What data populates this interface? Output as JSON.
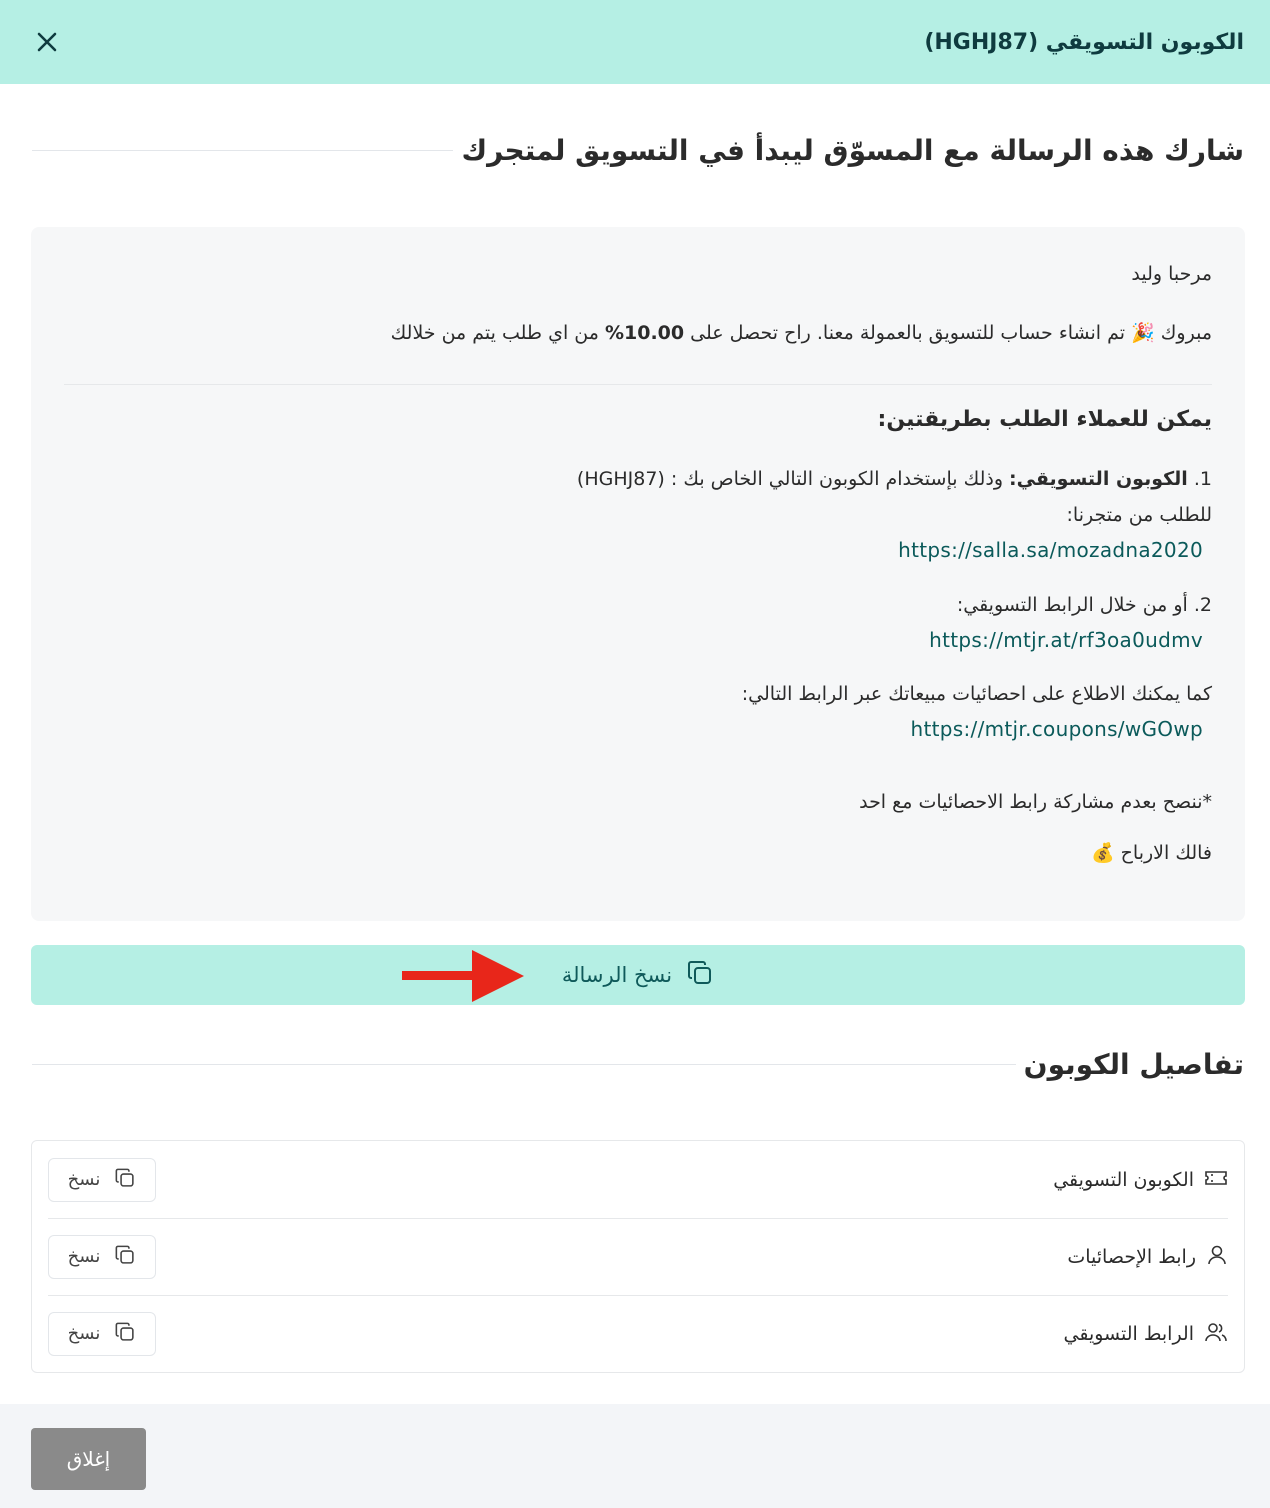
{
  "header": {
    "title": "الكوبون التسويقي (HGHJ87)",
    "close_icon": "close-icon"
  },
  "share_section": {
    "title": "شارك هذه الرسالة مع المسوّق ليبدأ في التسويق لمتجرك"
  },
  "message": {
    "greeting": "مرحبا وليد",
    "congrats_prefix": "مبروك 🎉 تم انشاء حساب للتسويق بالعمولة معنا. راح تحصل على ",
    "commission": "10.00%",
    "congrats_suffix": " من اي طلب يتم من خلالك",
    "ways_heading": "يمكن للعملاء الطلب بطريقتين:",
    "way1_prefix": "1. ",
    "way1_bold": "الكوبون التسويقي:",
    "way1_text": " وذلك بإستخدام الكوبون التالي الخاص بك : (HGHJ87)",
    "way1_line2": "للطلب من متجرنا:",
    "store_link": "https://salla.sa/mozadna2020",
    "way2_text": "2. أو من خلال الرابط التسويقي:",
    "marketing_link": "https://mtjr.at/rf3oa0udmv",
    "stats_text": "كما يمكنك الاطلاع على احصائيات مبيعاتك عبر الرابط التالي:",
    "stats_link": "https://mtjr.coupons/wGOwp",
    "advice": "*ننصح بعدم مشاركة رابط الاحصائيات مع احد",
    "closing": "فالك الارباح 💰"
  },
  "copy_message_button": {
    "label": "نسخ الرسالة",
    "icon": "copy-icon"
  },
  "coupon_details": {
    "title": "تفاصيل الكوبون",
    "rows": [
      {
        "label": "الكوبون التسويقي",
        "icon": "ticket-icon",
        "copy_label": "نسخ"
      },
      {
        "label": "رابط الإحصائيات",
        "icon": "user-icon",
        "copy_label": "نسخ"
      },
      {
        "label": "الرابط التسويقي",
        "icon": "users-icon",
        "copy_label": "نسخ"
      }
    ]
  },
  "footer": {
    "close_label": "إغلاق"
  },
  "colors": {
    "header_bg": "#b5efe4",
    "accent_text": "#0f5a5a",
    "arrow": "#e8261a",
    "footer_button": "#8a8a8a"
  }
}
